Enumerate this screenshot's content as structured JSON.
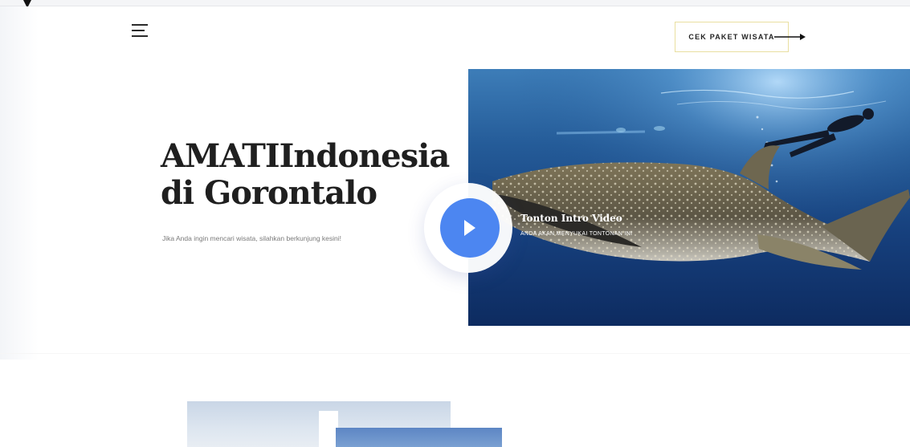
{
  "header": {
    "menu_icon": "hamburger-menu-icon",
    "cta_label": "CEK PAKET WISATA",
    "cta_arrow_icon": "arrow-right-icon"
  },
  "hero": {
    "title_line1": "AMATIIndonesia",
    "title_line2": "di Gorontalo",
    "subtitle": "Jika Anda ingin mencari wisata, silahkan berkunjung kesini!"
  },
  "video": {
    "play_icon": "play-icon",
    "title": "Tonton Intro Video",
    "subtitle": "ANDA AKAN MENYUKAI TONTONAN INI"
  },
  "colors": {
    "accent_blue": "#4c86f1",
    "cta_border": "#e9dfa0",
    "title_text": "#1f1f1f",
    "ocean_top": "#3d7db8",
    "ocean_bottom": "#0d2b60"
  }
}
